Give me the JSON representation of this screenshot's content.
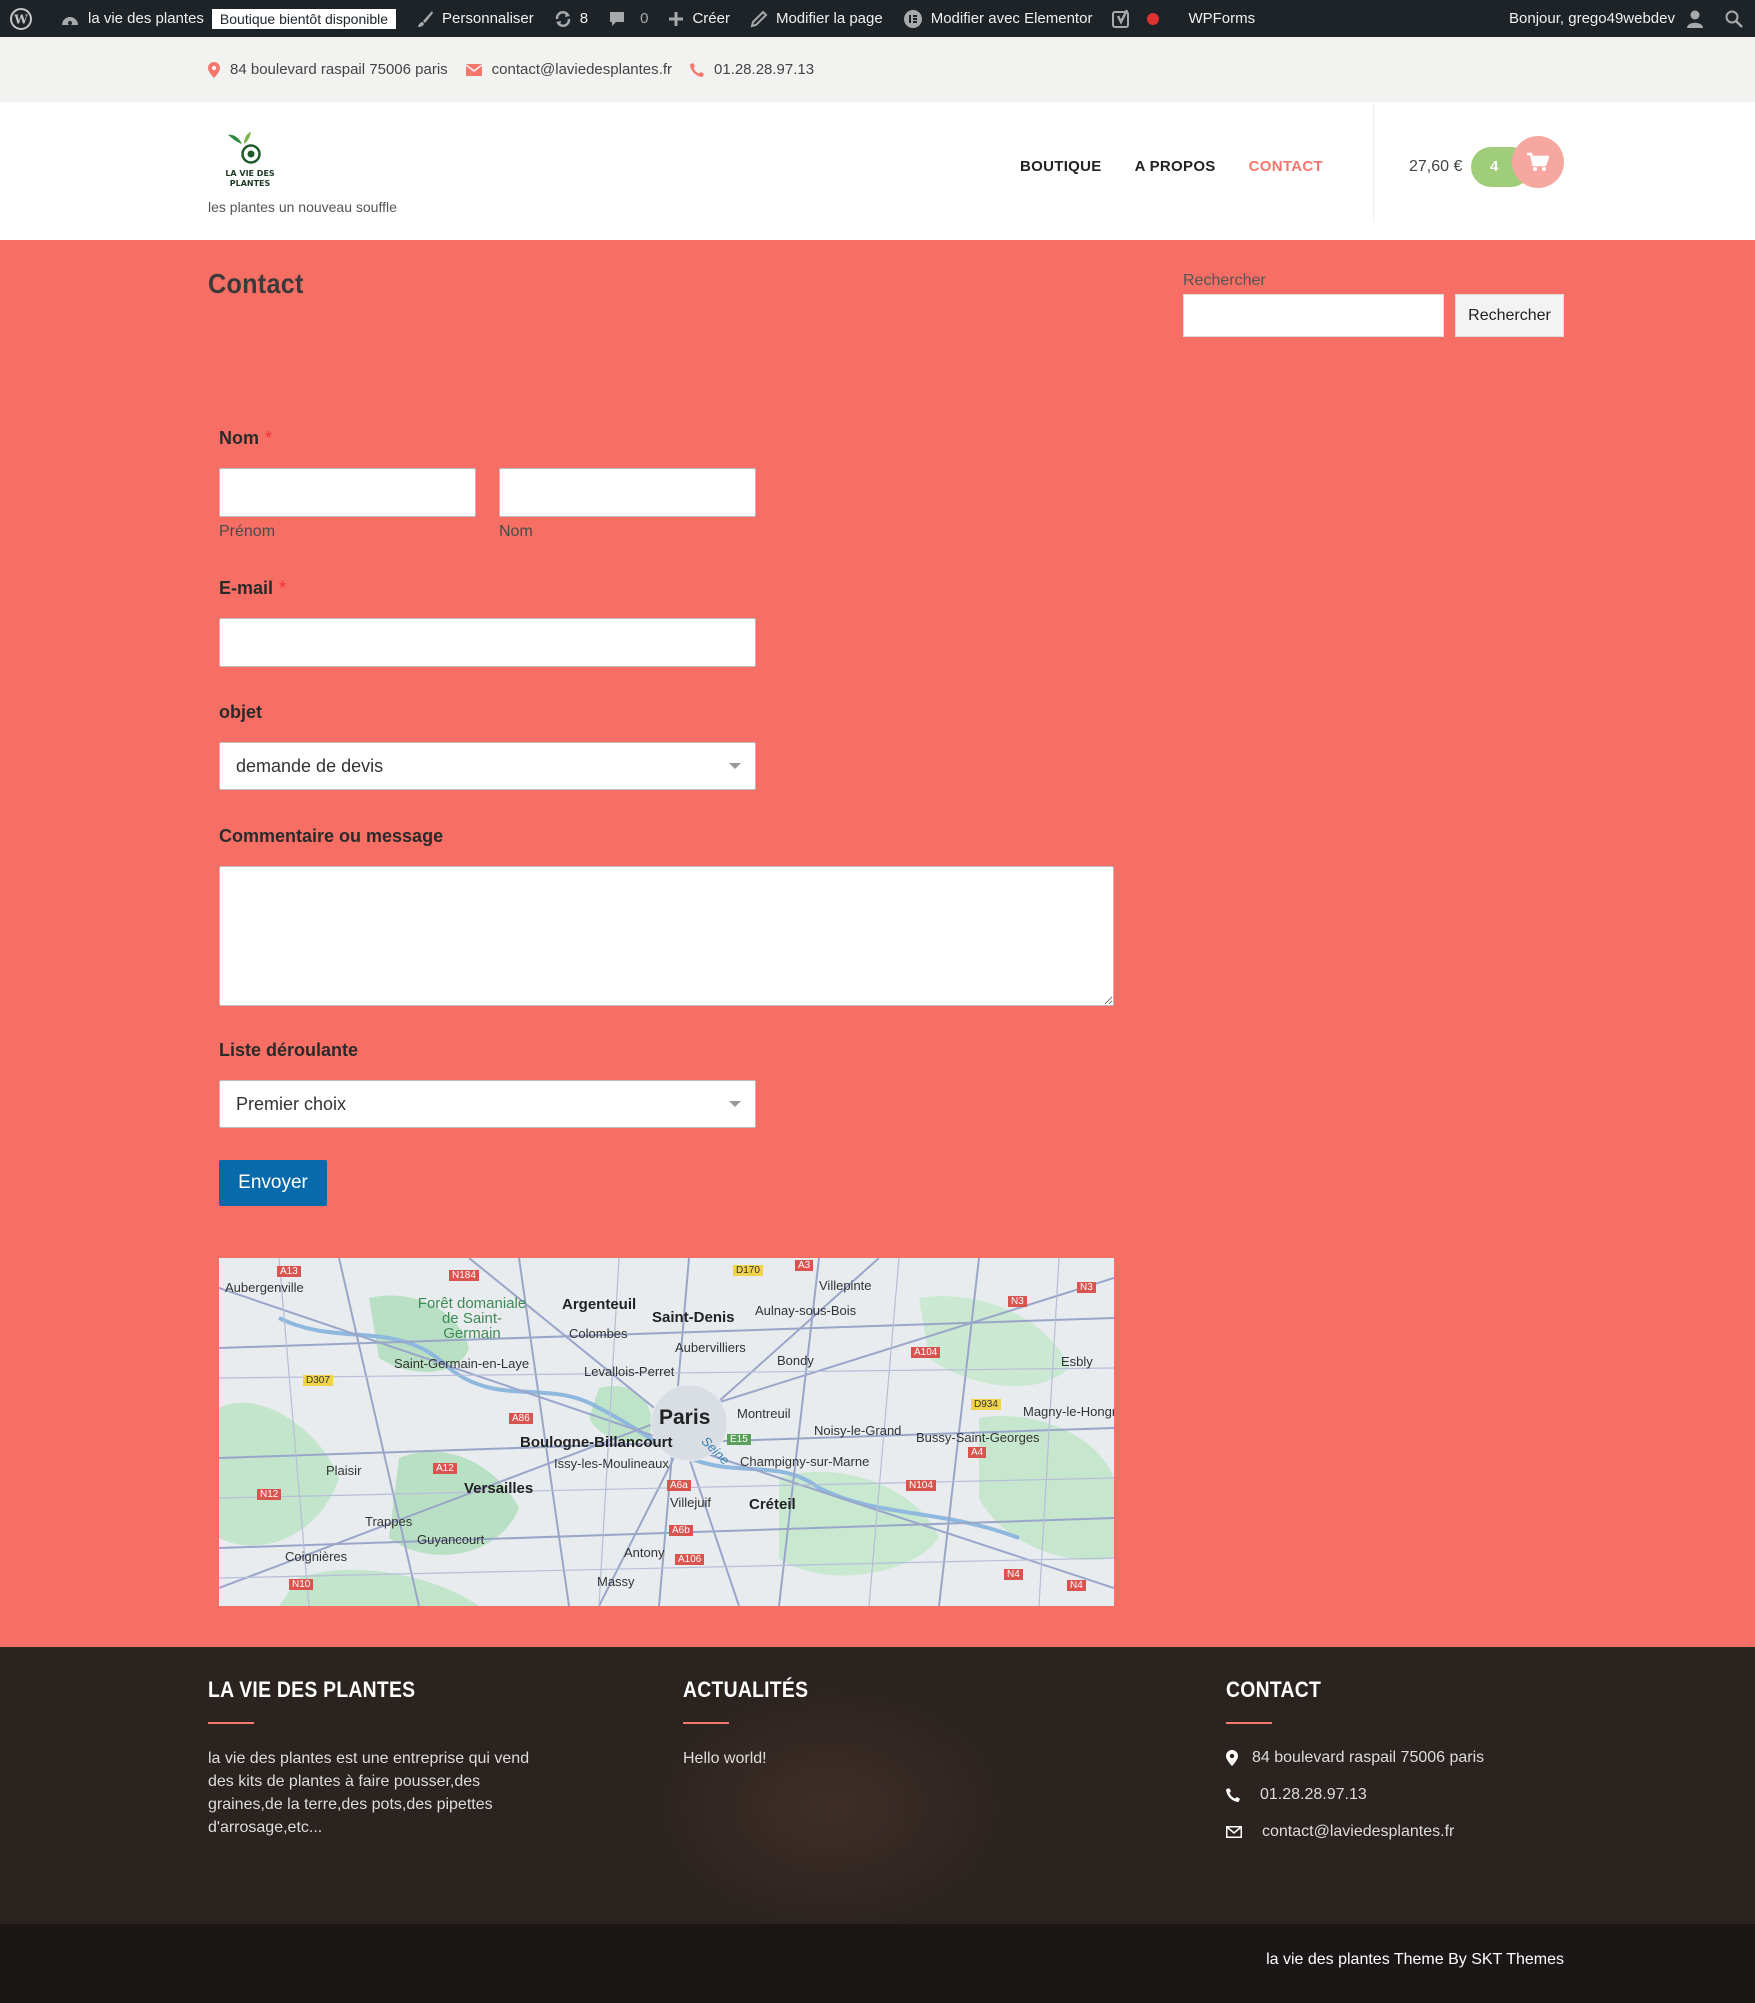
{
  "admin_bar": {
    "site_name": "la vie des plantes",
    "maintenance_badge": "Boutique bientôt disponible",
    "customize": "Personnaliser",
    "updates_count": "8",
    "comments_count": "0",
    "new": "Créer",
    "edit_page": "Modifier la page",
    "edit_elementor": "Modifier avec Elementor",
    "wpforms": "WPForms",
    "greeting": "Bonjour, grego49webdev"
  },
  "topbar": {
    "address": "84 boulevard raspail 75006 paris",
    "email": "contact@laviedesplantes.fr",
    "phone": "01.28.28.97.13"
  },
  "header": {
    "logo_text": "LA VIE DES PLANTES",
    "tagline": "les plantes un nouveau souffle",
    "nav": [
      "BOUTIQUE",
      "A PROPOS",
      "CONTACT"
    ],
    "cart_total": "27,60 €",
    "cart_count": "4"
  },
  "main": {
    "page_title": "Contact",
    "search": {
      "label": "Rechercher",
      "button": "Rechercher",
      "value": ""
    },
    "form": {
      "name_label": "Nom",
      "required_mark": "*",
      "first_sublabel": "Prénom",
      "last_sublabel": "Nom",
      "email_label": "E-mail",
      "subject_label": "objet",
      "subject_value": "demande de devis",
      "message_label": "Commentaire ou message",
      "dropdown_label": "Liste déroulante",
      "dropdown_value": "Premier choix",
      "submit": "Envoyer"
    },
    "map": {
      "big": "Paris",
      "mid": [
        "Argenteuil",
        "Saint-Denis",
        "Boulogne-Billancourt",
        "Versailles",
        "Créteil"
      ],
      "small": [
        "Aubergenville",
        "Forêt domaniale de Saint-Germain",
        "Colombes",
        "Aulnay-sous-Bois",
        "Villepinte",
        "Aubervilliers",
        "Saint-Germain-en-Laye",
        "Levallois-Perret",
        "Bondy",
        "Esbly",
        "Montreuil",
        "Noisy-le-Grand",
        "Magny-le-Hongre",
        "Bussy-Saint-Georges",
        "Issy-les-Moulineaux",
        "Champigny-sur-Marne",
        "Plaisir",
        "Villejuif",
        "Trappes",
        "Guyancourt",
        "Coignières",
        "Antony",
        "Massy",
        "Seine"
      ],
      "roads": [
        "A13",
        "N184",
        "D170",
        "A3",
        "N3",
        "N3",
        "A104",
        "D307",
        "A86",
        "D934",
        "E15",
        "A4",
        "A12",
        "N12",
        "A6a",
        "N104",
        "A6b",
        "A106",
        "N10",
        "N4",
        "N4"
      ]
    }
  },
  "footer": {
    "col1": {
      "title": "LA VIE DES PLANTES",
      "text": "la vie des plantes est une entreprise qui vend des kits de plantes à faire pousser,des graines,de la terre,des pots,des pipettes d'arrosage,etc..."
    },
    "col2": {
      "title": "ACTUALITÉS",
      "post": "Hello world!"
    },
    "col3": {
      "title": "CONTACT",
      "address": "84 boulevard raspail 75006 paris",
      "phone": "01.28.28.97.13",
      "email": "contact@laviedesplantes.fr"
    },
    "credit": "la vie des plantes Theme By SKT Themes"
  },
  "colors": {
    "page_bg": "#f76e64",
    "accent": "#f5766b",
    "cart_green": "#9fcd7a",
    "submit_blue": "#066aab",
    "footer_bg": "#2a2320"
  }
}
